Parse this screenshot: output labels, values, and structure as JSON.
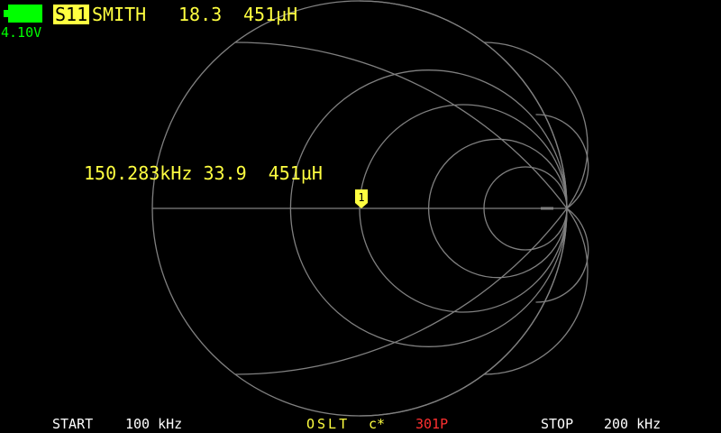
{
  "status": {
    "battery_voltage": "4.10V",
    "battery_icon": "battery-icon",
    "battery_color": "#00ff00"
  },
  "header": {
    "trace": "S11",
    "format": "SMITH",
    "value1": "18.3",
    "value2": "451µH"
  },
  "marker": {
    "number": "1",
    "readout": "150.283kHz 33.9  451µH",
    "color": "#ffff40"
  },
  "footer": {
    "start_label": "START",
    "start_value": "100 kHz",
    "cal": "OSLT",
    "cal_status": "c*",
    "points": "301P",
    "stop_label": "STOP",
    "stop_value": "200 kHz"
  },
  "colors": {
    "background": "#000000",
    "grid": "#808080",
    "trace": "#ffff40",
    "points": "#ff3030",
    "text": "#ffffff"
  }
}
